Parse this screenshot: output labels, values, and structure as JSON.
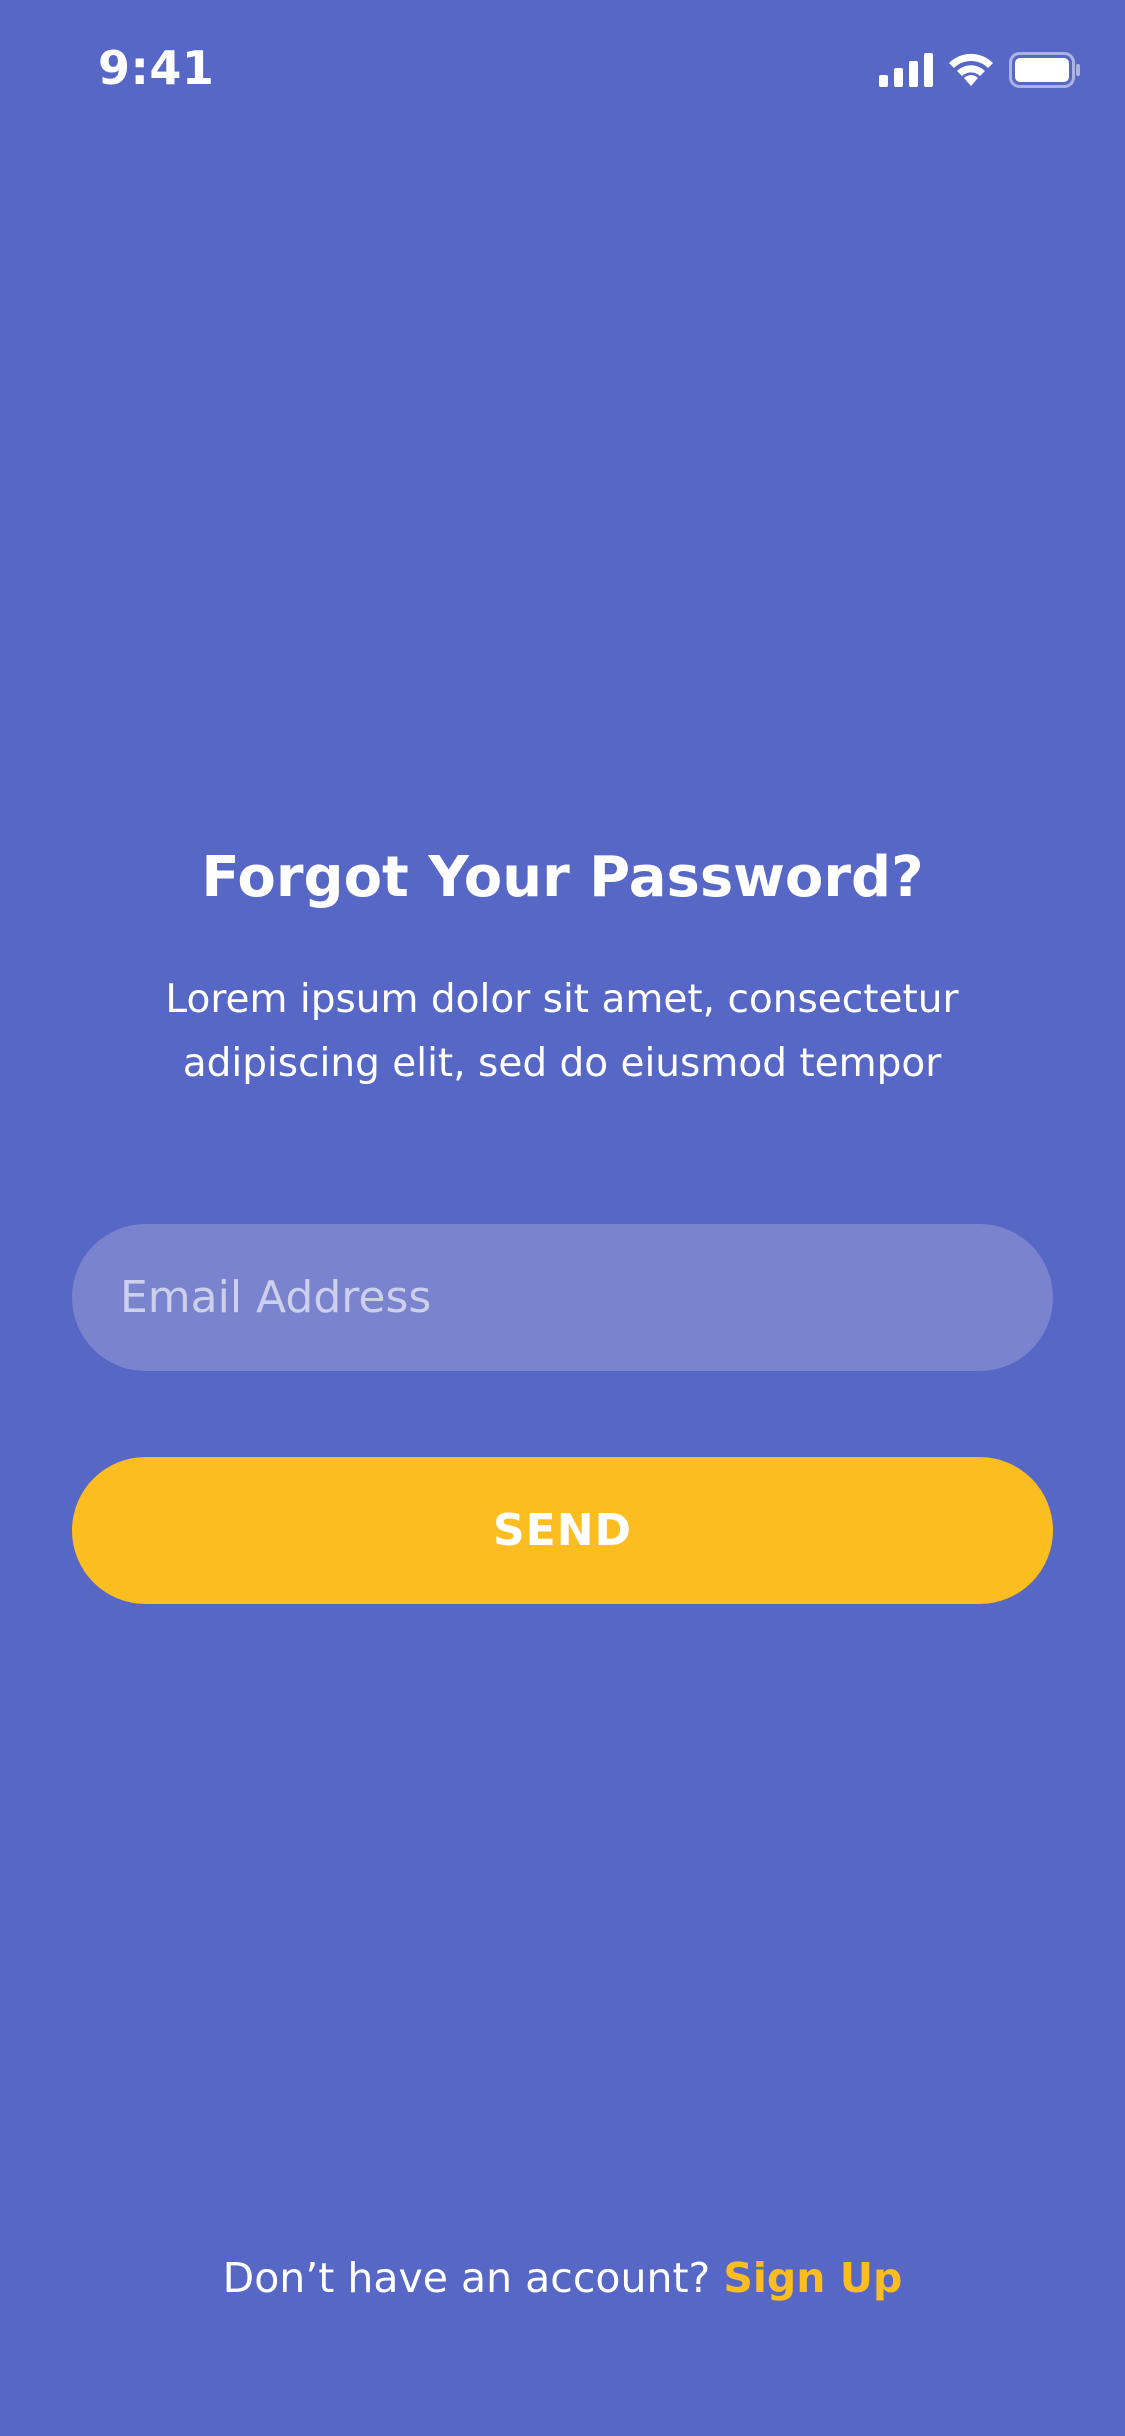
{
  "status_bar": {
    "time": "9:41",
    "icons": [
      "cellular-signal-icon",
      "wifi-icon",
      "battery-icon"
    ]
  },
  "heading": {
    "title": "Forgot Your Password?",
    "description_line1": "Lorem ipsum dolor sit amet, consectetur",
    "description_line2": "adipiscing elit, sed do eiusmod tempor"
  },
  "form": {
    "email": {
      "value": "",
      "placeholder": "Email Address"
    },
    "send_label": "SEND"
  },
  "footer": {
    "prompt_text": "Don’t have an account?",
    "signup_label": "Sign Up"
  },
  "colors": {
    "background": "#5767C5",
    "input_background": "#7A83CD",
    "accent": "#FBBD1F",
    "text": "#FFFFFF"
  }
}
